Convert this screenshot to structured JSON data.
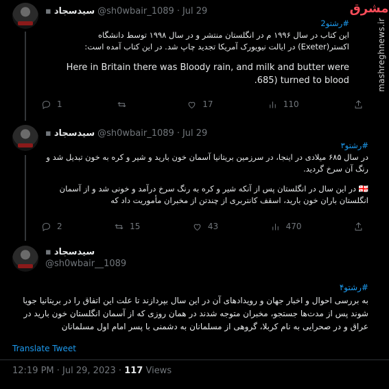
{
  "tweet1": {
    "display_name": "سیدسجاد",
    "handle": "@sh0wbair_1089",
    "sep": "·",
    "date": "Jul 29",
    "hashtag": "#رشتو2",
    "text_fa": "این کتاب در سال ۱۹۹۶ م در انگلستان منتشر و در سال ۱۹۹۸ توسط دانشگاه اکستر(Exeter) در ایالت نیویورک آمریکا تجدید چاپ شد. در این کتاب آمده است:",
    "text_en": "Here in Britain there was Bloody rain, and milk and butter were .685) turned to blood",
    "replies": "1",
    "retweets": "",
    "likes": "17",
    "views": "110"
  },
  "tweet2": {
    "display_name": "سیدسجاد",
    "handle": "@sh0wbair_1089",
    "sep": "·",
    "date": "Jul 29",
    "hashtag": "#رشتو۳",
    "text_fa1": "در سال ۶۸۵ میلادی در اینجا، در سرزمین بریتانیا آسمان خون بارید و شیر و کره به خون تبدیل شد و رنگ آن سرخ گردید.",
    "text_fa2": "🇬🇪 در این سال در انگلستان پس از آنکه شیر و کره به رنگ سرخ درآمد و خونی شد و از آسمان انگلستان باران خون بارید، اسقف کانتربری از چندتن از مخبران مأموریت داد که",
    "replies": "2",
    "retweets": "15",
    "likes": "43",
    "views": "470"
  },
  "tweet3": {
    "display_name": "سیدسجاد",
    "handle": "@sh0wbair__1089",
    "hashtag": "#رشتو۴",
    "text_fa": "به بررسی احوال و اخبار جهان و رویدادهای آن در این سال بپردازند تا علت این اتفاق را در بریتانیا جویا شوند پس از مدت‌ها جستجو، مخبران متوجه شدند در همان روزی که از آسمان انگلستان خون بارید در عراق و در صحرایی به نام کربلا، گروهی از مسلمانان به دشمنی با پسر امام اول مسلمانان",
    "translate": "Translate Tweet",
    "time": "12:19 PM · Jul 29, 2023",
    "sep": "·",
    "views_count": "117",
    "views_label": "Views"
  },
  "watermark": {
    "logo": "مشرق",
    "site": "mashreghnews.ir"
  }
}
